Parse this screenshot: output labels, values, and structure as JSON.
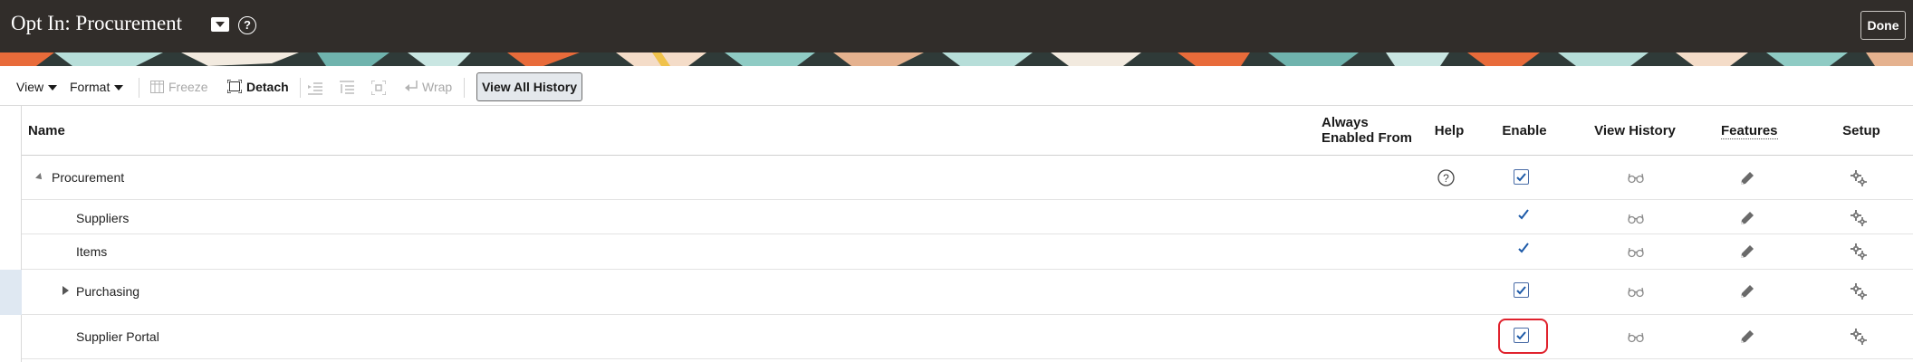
{
  "header": {
    "title": "Opt In: Procurement",
    "title_menu_icon": "dropdown-arrow-icon",
    "help_icon": "help-icon",
    "done_label": "Done"
  },
  "toolbar": {
    "view_label": "View",
    "format_label": "Format",
    "freeze_label": "Freeze",
    "detach_label": "Detach",
    "wrap_label": "Wrap",
    "view_all_history_label": "View All History"
  },
  "table": {
    "columns": {
      "name": "Name",
      "always_enabled_from_1": "Always",
      "always_enabled_from_2": "Enabled From",
      "help": "Help",
      "enable": "Enable",
      "view_history": "View History",
      "features": "Features",
      "setup": "Setup"
    },
    "rows": [
      {
        "name": "Procurement",
        "expanded": true,
        "help": true,
        "enable": "checkbox-checked"
      },
      {
        "name": "Suppliers",
        "enable": "checkmark"
      },
      {
        "name": "Items",
        "enable": "checkmark"
      },
      {
        "name": "Purchasing",
        "collapsed": true,
        "enable": "checkbox-checked",
        "selected": true
      },
      {
        "name": "Supplier Portal",
        "enable": "checkbox-checked",
        "highlighted": true
      }
    ]
  },
  "colors": {
    "header_bg": "#312d2a",
    "accent_blue": "#1d5aa8",
    "highlight_red": "#e0222d"
  }
}
